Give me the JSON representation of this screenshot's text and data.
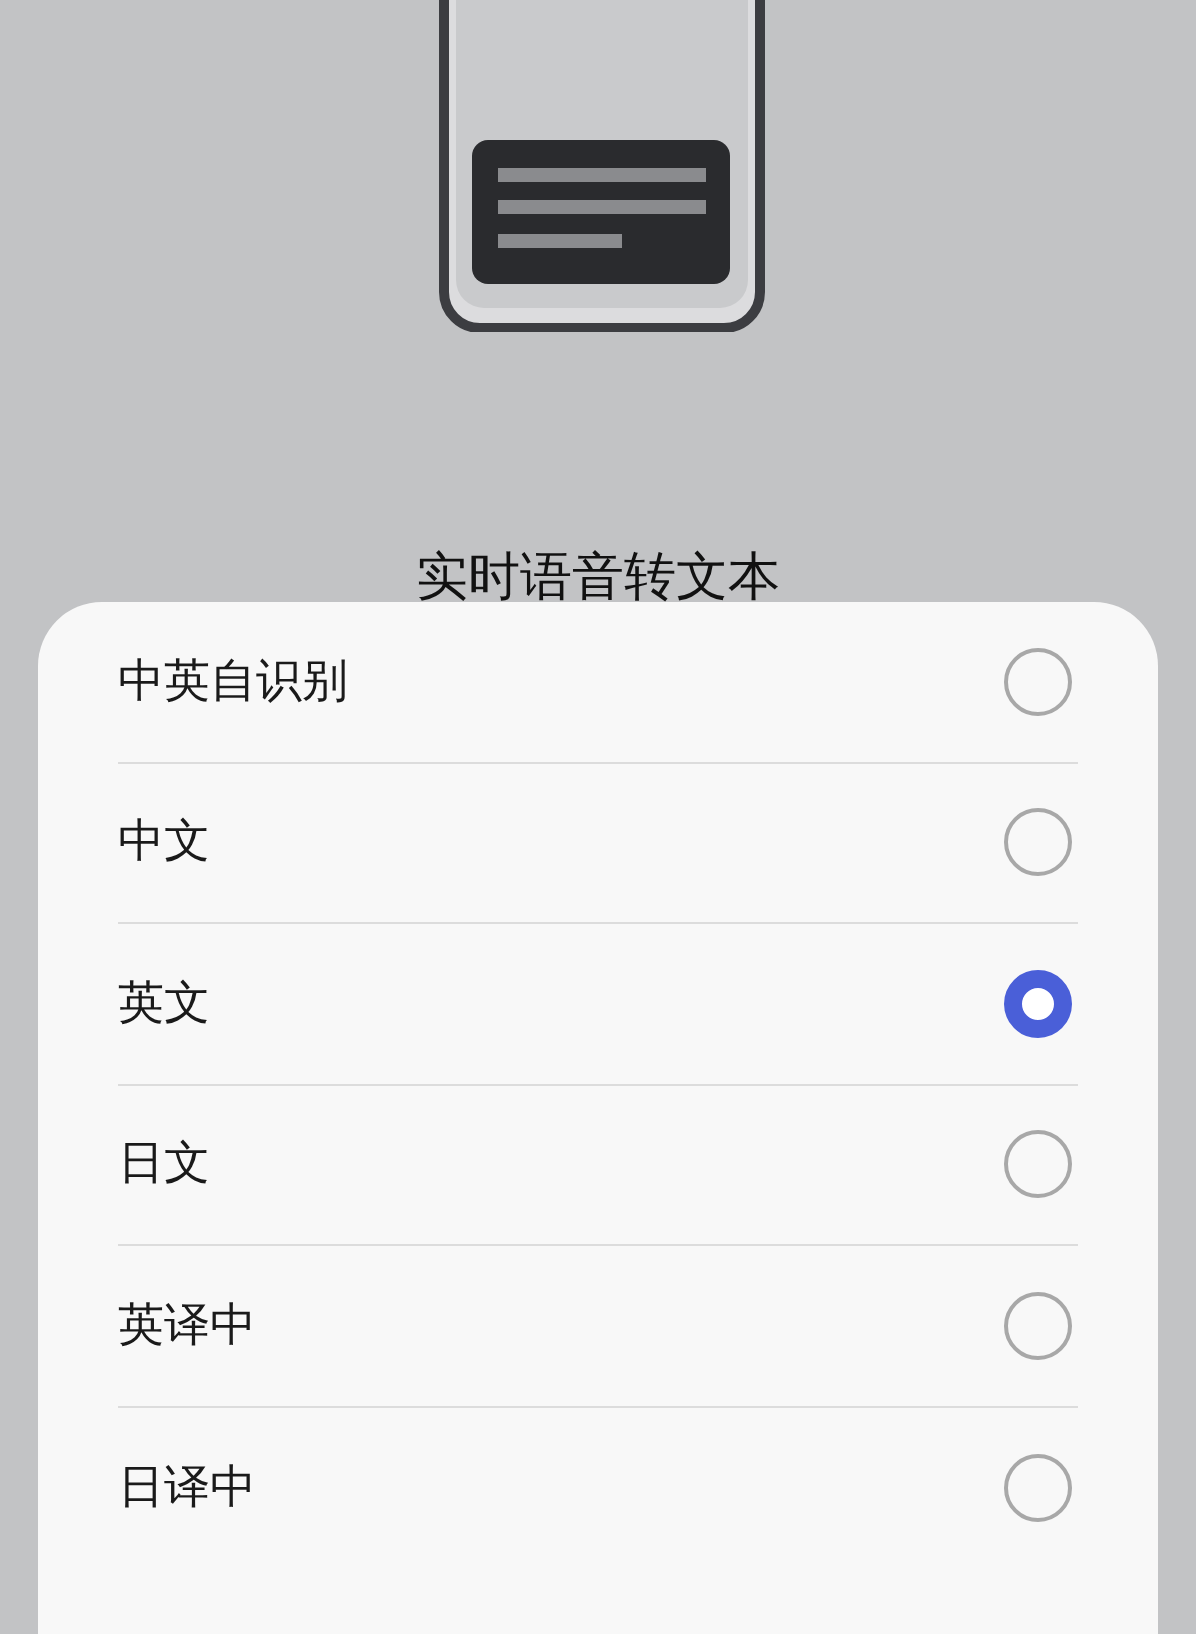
{
  "title": "实时语音转文本",
  "options": [
    {
      "label": "中英自识别",
      "selected": false
    },
    {
      "label": "中文",
      "selected": false
    },
    {
      "label": "英文",
      "selected": true
    },
    {
      "label": "日文",
      "selected": false
    },
    {
      "label": "英译中",
      "selected": false
    },
    {
      "label": "日译中",
      "selected": false
    }
  ]
}
